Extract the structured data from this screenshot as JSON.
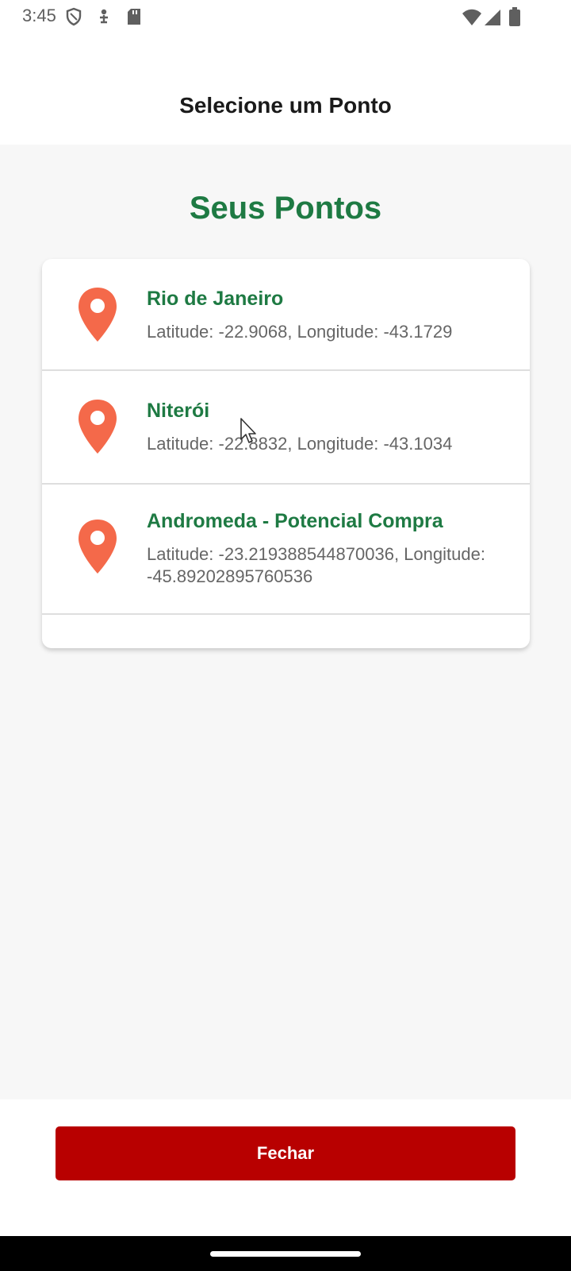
{
  "status_bar": {
    "time": "3:45",
    "left_icons": [
      "shield-icon",
      "person-icon",
      "sd-card-icon"
    ],
    "right_icons": [
      "wifi-icon",
      "signal-icon",
      "battery-icon"
    ]
  },
  "header": {
    "title": "Selecione um Ponto"
  },
  "main": {
    "section_title": "Seus Pontos",
    "points": [
      {
        "name": "Rio de Janeiro",
        "coords": "Latitude: -22.9068, Longitude: -43.1729",
        "icon": "location-pin-icon"
      },
      {
        "name": "Niterói",
        "coords": "Latitude: -22.8832, Longitude: -43.1034",
        "icon": "location-pin-icon"
      },
      {
        "name": "Andromeda - Potencial Compra",
        "coords": "Latitude: -23.219388544870036, Longitude: -45.89202895760536",
        "icon": "location-pin-icon"
      }
    ]
  },
  "footer": {
    "close_label": "Fechar"
  },
  "colors": {
    "accent_green": "#1e7a43",
    "pin_orange": "#f4694a",
    "button_red": "#b80000",
    "background": "#f7f7f7"
  }
}
